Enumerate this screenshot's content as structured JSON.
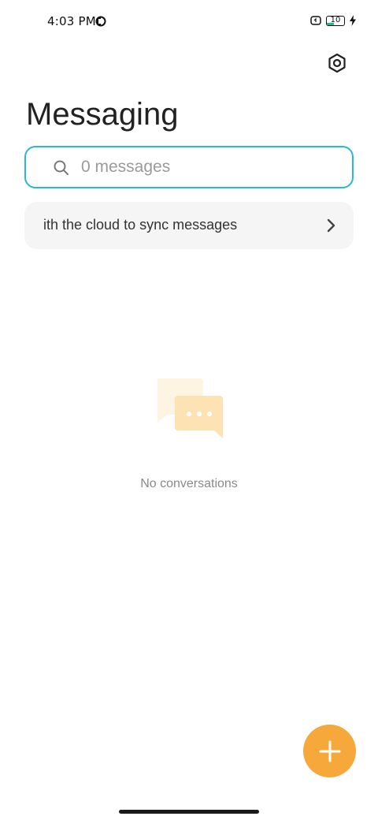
{
  "status_bar": {
    "time": "4:03 PM",
    "battery_level": "10",
    "app_icon": "app-notification-icon",
    "alarm_icon": "alarm-icon",
    "charging_icon": "bolt-icon"
  },
  "header": {
    "title": "Messaging",
    "settings_icon": "settings-icon"
  },
  "search": {
    "placeholder": "0 messages",
    "icon": "search-icon"
  },
  "sync_banner": {
    "text": "ith the cloud to sync messages",
    "icon": "chevron-right-icon"
  },
  "empty_state": {
    "illustration": "chat-bubbles-icon",
    "text": "No conversations"
  },
  "fab": {
    "icon": "plus-icon",
    "color": "#f6a83a"
  },
  "colors": {
    "accent": "#29b9d4",
    "fab": "#f6a83a",
    "battery_fill": "#17c08a"
  }
}
